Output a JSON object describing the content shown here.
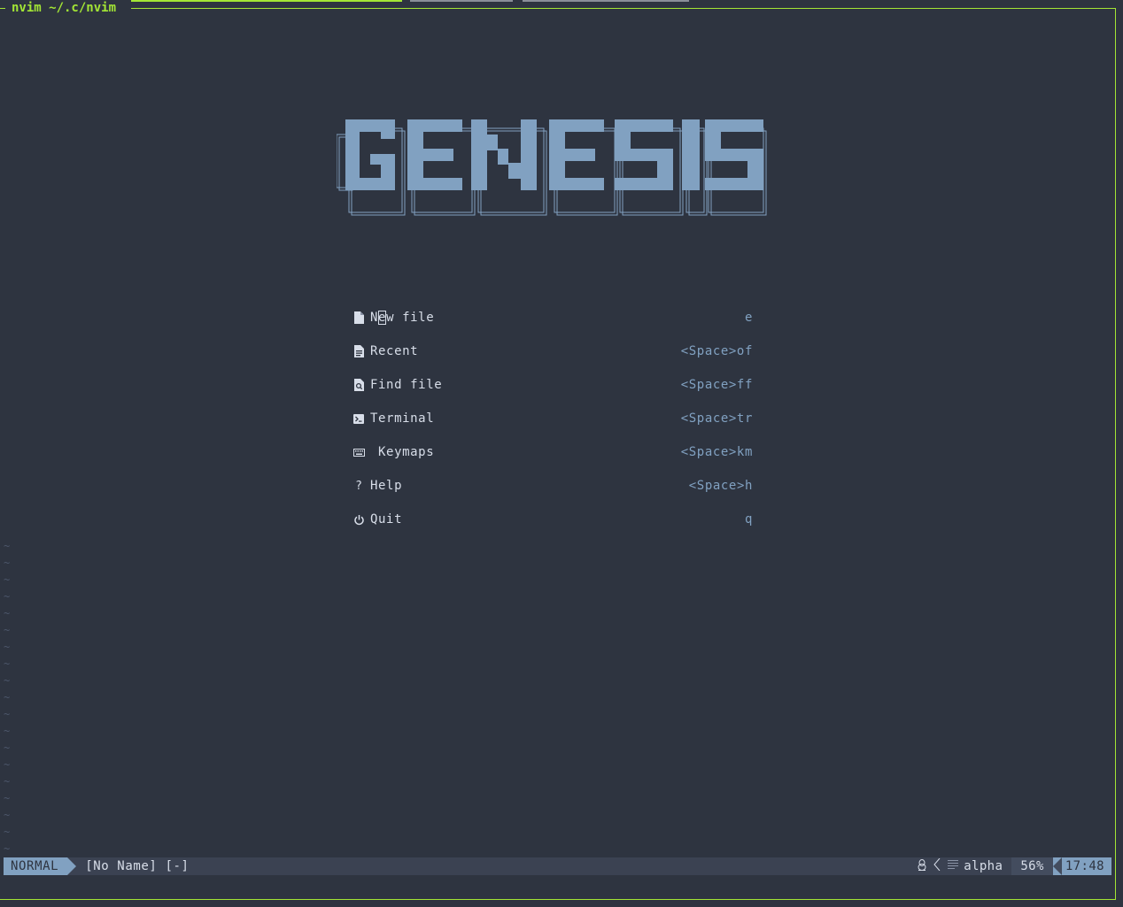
{
  "window": {
    "title": "nvim ~/.c/nvim"
  },
  "colors": {
    "background": "#2e3440",
    "accent": "#a3e635",
    "logo": "#81a1c1",
    "shortcut": "#81a1c1",
    "foreground": "#d8dee9"
  },
  "dashboard": {
    "logo_text": "GENESIS",
    "items": [
      {
        "icon": "file-icon",
        "label": "New file",
        "shortcut": "e"
      },
      {
        "icon": "recent-file-icon",
        "label": "Recent",
        "shortcut": "<Space>of"
      },
      {
        "icon": "find-file-icon",
        "label": "Find file",
        "shortcut": "<Space>ff"
      },
      {
        "icon": "terminal-icon",
        "label": "Terminal",
        "shortcut": "<Space>tr"
      },
      {
        "icon": "keyboard-icon",
        "label": " Keymaps",
        "shortcut": "<Space>km"
      },
      {
        "icon": "question-icon",
        "label": "Help",
        "shortcut": "<Space>h"
      },
      {
        "icon": "power-icon",
        "label": "Quit",
        "shortcut": "q"
      }
    ]
  },
  "statusline": {
    "mode": "NORMAL",
    "filename": "[No Name] [-]",
    "filetype": "alpha",
    "percent": "56%",
    "time": "17:48",
    "os_icon": "linux-penguin-icon"
  }
}
